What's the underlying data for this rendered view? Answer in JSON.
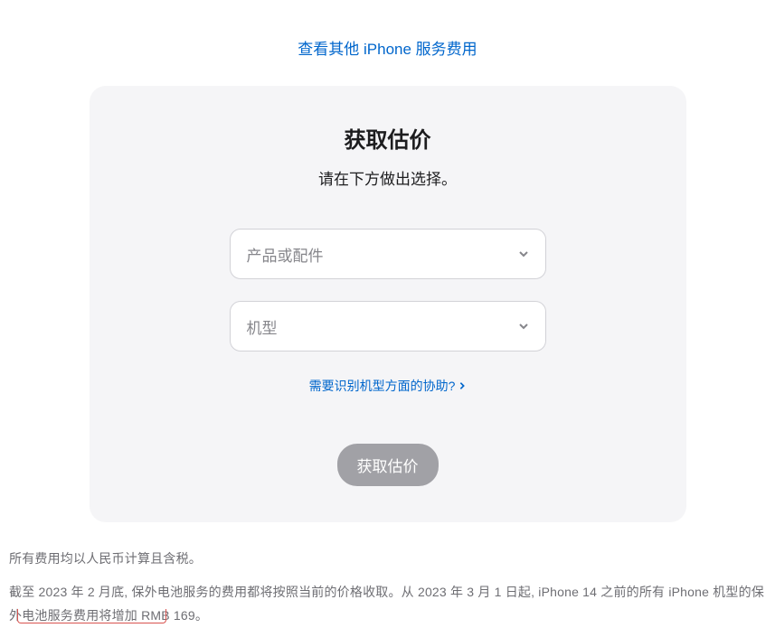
{
  "topLink": {
    "text": "查看其他 iPhone 服务费用"
  },
  "card": {
    "title": "获取估价",
    "subtitle": "请在下方做出选择。",
    "productSelect": {
      "placeholder": "产品或配件"
    },
    "modelSelect": {
      "placeholder": "机型"
    },
    "helpLink": {
      "text": "需要识别机型方面的协助?"
    },
    "submitButton": {
      "label": "获取估价"
    }
  },
  "footer": {
    "line1": "所有费用均以人民币计算且含税。",
    "line2": "截至 2023 年 2 月底, 保外电池服务的费用都将按照当前的价格收取。从 2023 年 3 月 1 日起, iPhone 14 之前的所有 iPhone 机型的保外电池服务费用将增加 RMB 169。"
  }
}
